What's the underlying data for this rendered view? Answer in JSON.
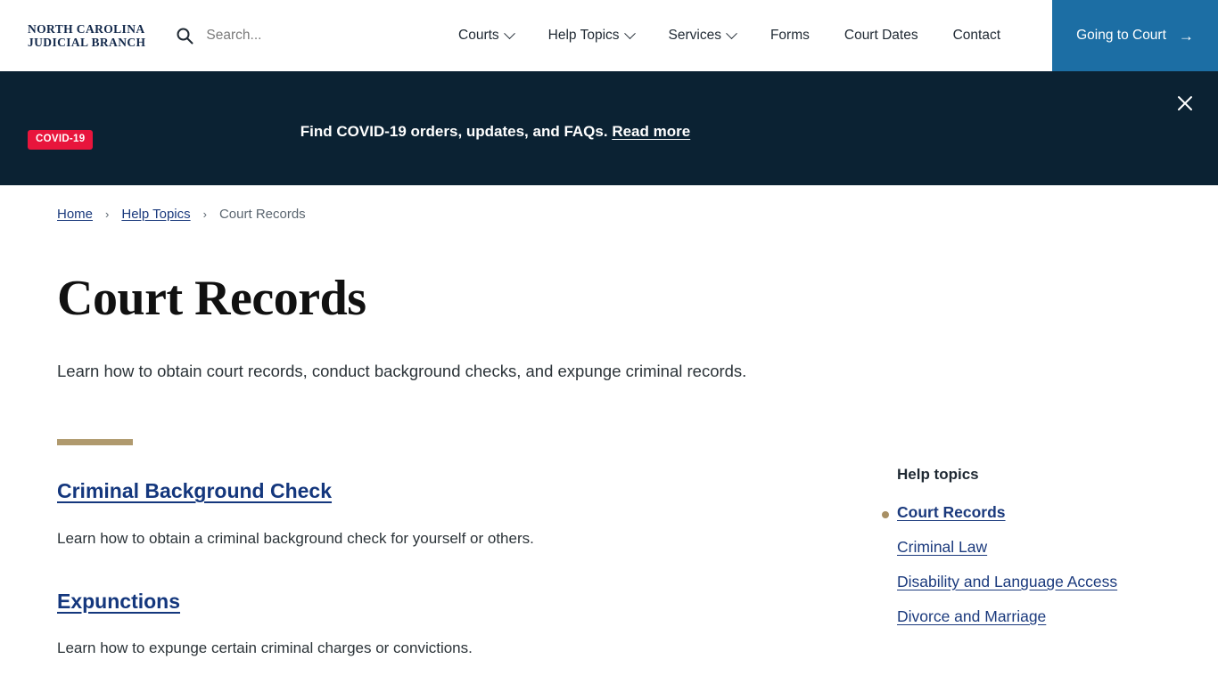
{
  "header": {
    "logo_line1": "NORTH CAROLINA",
    "logo_line2": "JUDICIAL BRANCH",
    "search_placeholder": "Search...",
    "search_value": "",
    "nav": [
      {
        "label": "Courts",
        "has_caret": true
      },
      {
        "label": "Help Topics",
        "has_caret": true
      },
      {
        "label": "Services",
        "has_caret": true
      },
      {
        "label": "Forms",
        "has_caret": false
      },
      {
        "label": "Court Dates",
        "has_caret": false
      },
      {
        "label": "Contact",
        "has_caret": false
      }
    ],
    "cta_label": "Going to Court",
    "cta_arrow": "→",
    "cta_color": "#1C6EA4"
  },
  "banner": {
    "badge": "COVID-19",
    "badge_color": "#E8153C",
    "background": "#0B2233",
    "message": "Find COVID-19 orders, updates, and FAQs.",
    "link_label": "Read more",
    "close_glyph": "✕"
  },
  "breadcrumb": {
    "items": [
      {
        "label": "Home",
        "is_link": true
      },
      {
        "label": "Help Topics",
        "is_link": true
      },
      {
        "label": "Court Records",
        "is_link": false
      }
    ],
    "separator": "›"
  },
  "main": {
    "title": "Court Records",
    "description": "Learn how to obtain court records, conduct background checks, and expunge criminal records.",
    "rule_color": "#B09A6E",
    "topics": [
      {
        "title": "Criminal Background Check",
        "description": "Learn how to obtain a criminal background check for yourself or others."
      },
      {
        "title": "Expunctions",
        "description": "Learn how to expunge certain criminal charges or convictions."
      }
    ]
  },
  "sidebar": {
    "title": "Help topics",
    "bullet_color": "#A89065",
    "items": [
      {
        "label": "Court Records",
        "active": true
      },
      {
        "label": "Criminal Law",
        "active": false
      },
      {
        "label": "Disability and Language Access",
        "active": false
      },
      {
        "label": "Divorce and Marriage",
        "active": false
      }
    ]
  }
}
